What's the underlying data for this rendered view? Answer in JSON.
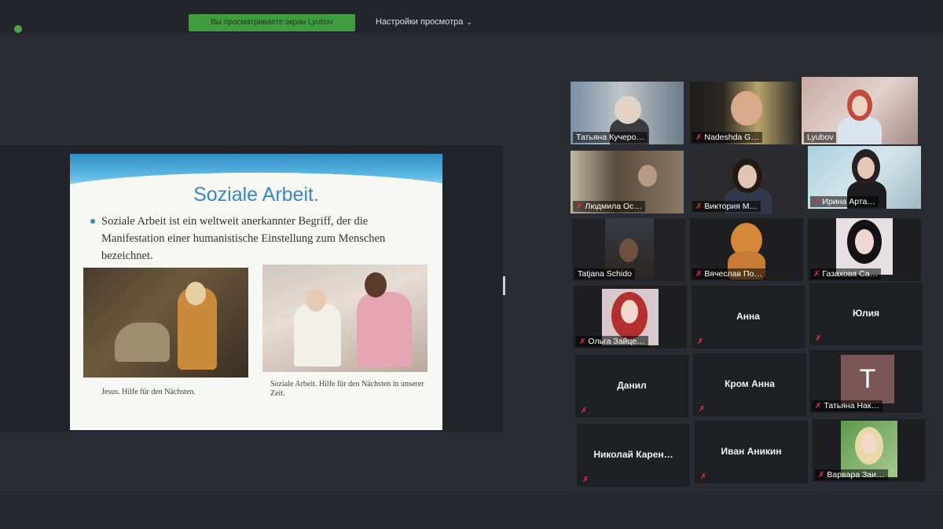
{
  "header": {
    "share_banner": "Вы просматриваете экран Lyubov",
    "view_options_label": "Настройки просмотра",
    "view_options_icon": "chevron-down-icon"
  },
  "slide": {
    "title": "Soziale Arbeit.",
    "bullet": "Soziale Arbeit ist ein weltweit anerkannter Begriff, der die Manifestation einer humanistische Einstellung zum Menschen bezeichnet.",
    "caption_left": "Jesus. Hilfe für den Nächsten.",
    "caption_right": "Soziale Arbeit. Hilfe für den Nächsten in unserer Zeit."
  },
  "participants": [
    {
      "name": "Татьяна Кучеро…",
      "muted": false
    },
    {
      "name": "Nadeshda G…",
      "muted": true
    },
    {
      "name": "Lyubov",
      "muted": false,
      "active_speaker": true
    },
    {
      "name": "Людмила Ос…",
      "muted": true
    },
    {
      "name": "Виктория М…",
      "muted": true
    },
    {
      "name": "Ирина Арта…",
      "muted": true
    },
    {
      "name": "Tatjana Schido",
      "muted": false
    },
    {
      "name": "Вячеслав По…",
      "muted": true
    },
    {
      "name": "Газахова Са…",
      "muted": true
    },
    {
      "name": "Ольга Зайце…",
      "muted": true
    },
    {
      "name": "Анна",
      "muted": true
    },
    {
      "name": "Юлия",
      "muted": true
    },
    {
      "name": "Данил",
      "muted": true
    },
    {
      "name": "Кром Анна",
      "muted": true
    },
    {
      "name": "Татьяна Нак…",
      "muted": true,
      "avatar_letter": "T"
    },
    {
      "name": "Николай  Карен…",
      "muted": true
    },
    {
      "name": "Иван Аникин",
      "muted": true
    },
    {
      "name": "Варвара Заи…",
      "muted": true
    }
  ],
  "colors": {
    "active_border": "#c7d63a",
    "share_banner": "#3f9d40",
    "mute_icon": "#e0364a"
  }
}
